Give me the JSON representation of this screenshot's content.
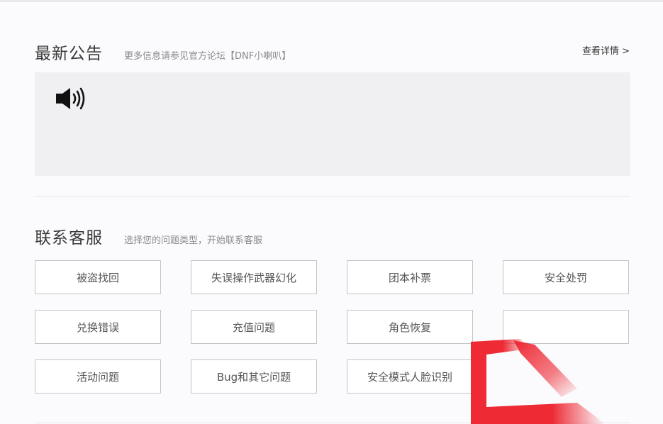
{
  "announcement": {
    "title": "最新公告",
    "subtitle": "更多信息请参见官方论坛【DNF小喇叭】",
    "detail_link": "查看详情 >",
    "icon": "speaker-icon"
  },
  "contact": {
    "title": "联系客服",
    "subtitle": "选择您的问题类型，开始联系客服",
    "buttons": [
      "被盗找回",
      "失误操作武器幻化",
      "团本补票",
      "安全处罚",
      "兑换错误",
      "充值问题",
      "角色恢复",
      "",
      "活动问题",
      "Bug和其它问题",
      "安全模式人脸识别"
    ]
  },
  "colors": {
    "background": "#fbfbfd",
    "notice_bg": "#f0f0f3",
    "button_border": "#c4c4c8",
    "accent_red": "#ee2a35"
  }
}
